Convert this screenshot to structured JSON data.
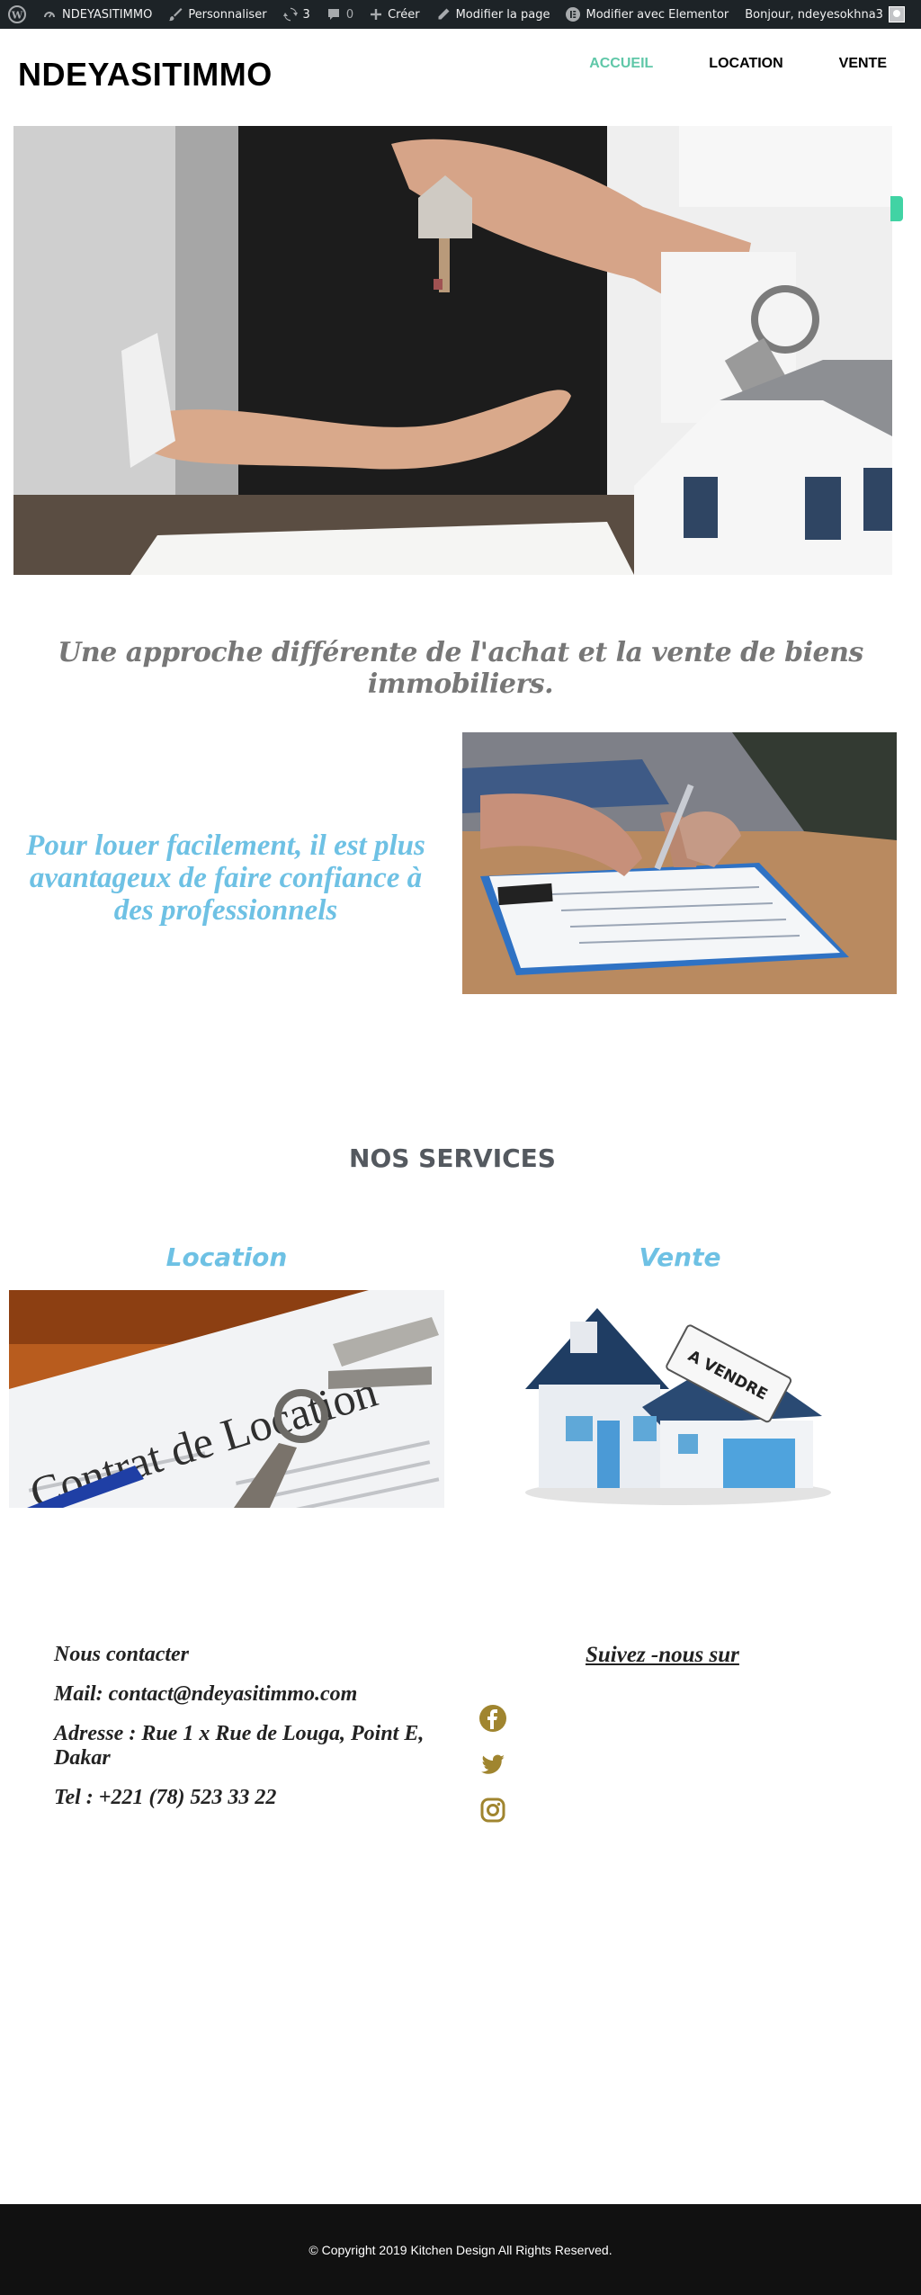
{
  "admin_bar": {
    "site_name": "NDEYASITIMMO",
    "customize": "Personnaliser",
    "updates_count": "3",
    "comments_count": "0",
    "create": "Créer",
    "edit_page": "Modifier la page",
    "edit_elementor": "Modifier avec Elementor",
    "greeting": "Bonjour, ndeyesokhna3"
  },
  "header": {
    "logo": "NDEYASITIMMO",
    "nav": [
      {
        "label": "ACCUEIL",
        "active": true
      },
      {
        "label": "LOCATION",
        "active": false
      },
      {
        "label": "VENTE",
        "active": false
      }
    ]
  },
  "tagline": "Une approche différente de l'achat et la vente de biens immobiliers.",
  "pitch": "Pour louer facilement, il est plus avantageux de faire confiance à des professionnels",
  "services": {
    "title": "NOS SERVICES",
    "items": [
      {
        "title": "Location",
        "image_text": "Contrat de Location"
      },
      {
        "title": "Vente",
        "image_text": "A VENDRE"
      }
    ]
  },
  "contact": {
    "heading": "Nous contacter",
    "mail": "Mail:  contact@ndeyasitimmo.com",
    "address": "Adresse : Rue 1 x Rue de Louga, Point E, Dakar",
    "tel": "Tel : +221 (78) 523 33 22"
  },
  "follow": "Suivez -nous sur",
  "social_icons": [
    "facebook-icon",
    "twitter-icon",
    "instagram-icon"
  ],
  "footer": "© Copyright 2019 Kitchen Design All Rights Reserved.",
  "colors": {
    "accent_nav": "#5fc7a8",
    "accent_title": "#6ec1e4",
    "social_icon": "#a0852f",
    "admin_bar": "#1d2327",
    "footer_bg": "#111111"
  }
}
